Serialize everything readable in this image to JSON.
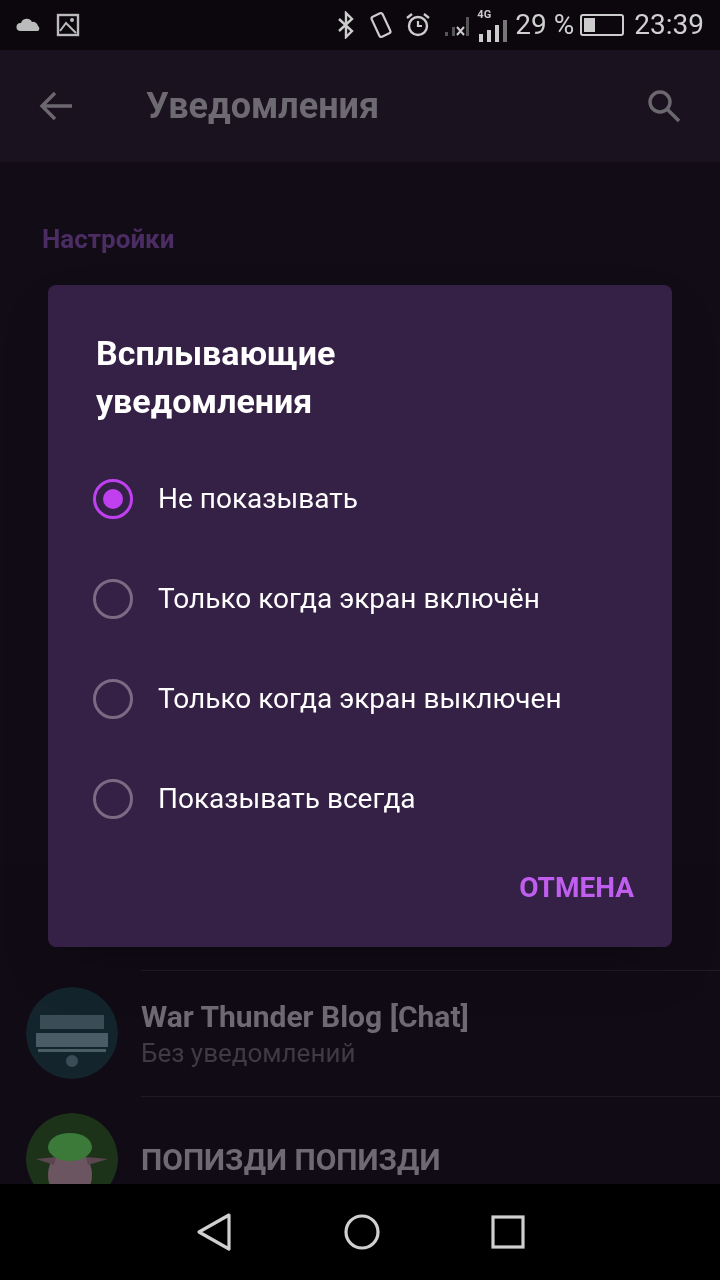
{
  "status_bar": {
    "battery_text": "29 %",
    "time": "23:39",
    "network": "4G"
  },
  "app_bar": {
    "title": "Уведомления"
  },
  "section": {
    "title": "Настройки"
  },
  "chats": [
    {
      "name": "War Thunder Blog [Chat]",
      "subtitle": "Без уведомлений",
      "kind": "picture"
    },
    {
      "name": "ПОПИЗДИ ПОПИЗДИ",
      "kind": "picture"
    }
  ],
  "dialog": {
    "title": "Всплывающие уведомления",
    "options": [
      {
        "label": "Не показывать",
        "selected": true
      },
      {
        "label": "Только когда экран включён",
        "selected": false
      },
      {
        "label": "Только когда экран выключен",
        "selected": false
      },
      {
        "label": "Показывать всегда",
        "selected": false
      }
    ],
    "cancel": "ОТМЕНА"
  }
}
